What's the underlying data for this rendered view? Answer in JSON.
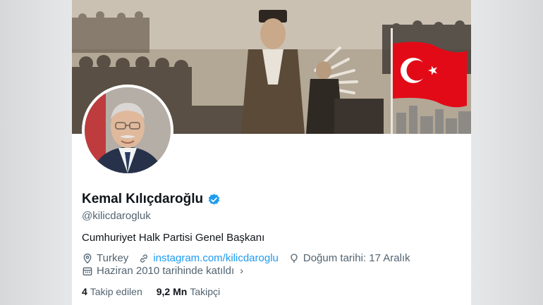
{
  "profile": {
    "name": "Kemal Kılıçdaroğlu",
    "handle": "@kilicdarogluk",
    "bio": "Cumhuriyet Halk Partisi Genel Başkanı",
    "location": "Turkey",
    "website": "instagram.com/kilicdaroglu",
    "birthday": "Doğum tarihi: 17 Aralık",
    "joined": "Haziran 2010 tarihinde katıldı",
    "following_count": "4",
    "following_label": "Takip edilen",
    "followers_count": "9,2 Mn",
    "followers_label": "Takipçi"
  },
  "icons": {
    "verified": "verified-badge-icon",
    "location": "location-pin-icon",
    "link": "link-icon",
    "birthday": "balloon-icon",
    "calendar": "calendar-icon"
  },
  "colors": {
    "accent": "#1d9bf0",
    "text_primary": "#0f1419",
    "text_secondary": "#536471",
    "flag_red": "#e30a17"
  }
}
